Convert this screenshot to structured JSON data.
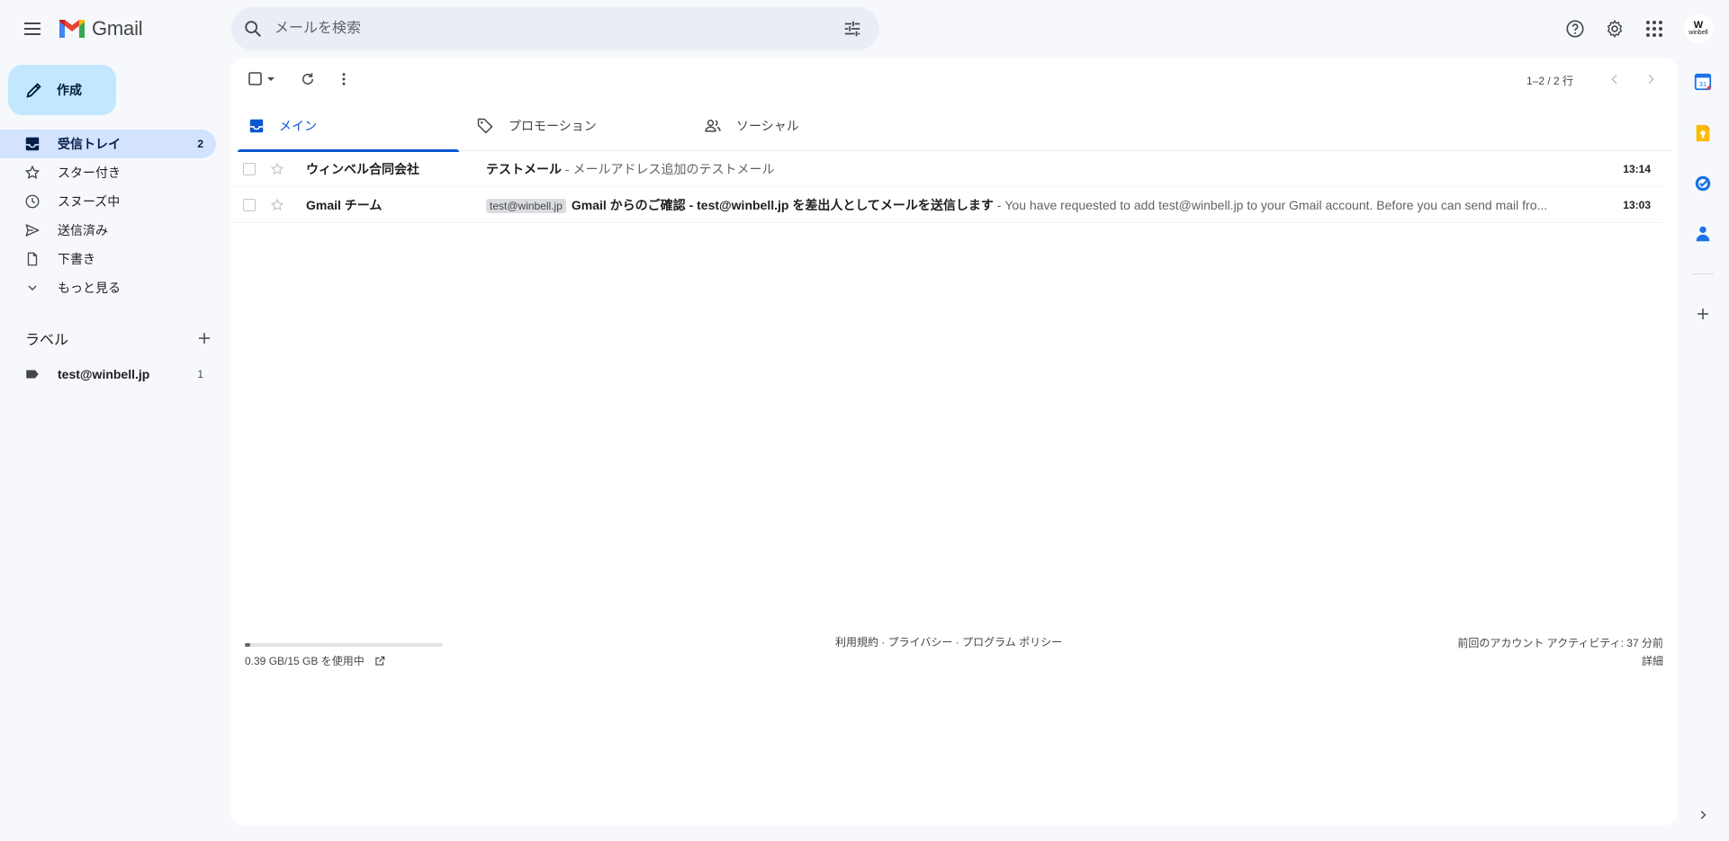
{
  "app": {
    "brand": "Gmail"
  },
  "search": {
    "placeholder": "メールを検索"
  },
  "colors": {
    "accent": "#0b57d0",
    "compose_bg": "#c2e7ff",
    "active_nav": "#d3e3fd"
  },
  "compose": {
    "label": "作成"
  },
  "nav": {
    "items": [
      {
        "label": "受信トレイ",
        "count": "2",
        "icon": "inbox-icon"
      },
      {
        "label": "スター付き",
        "count": "",
        "icon": "star-icon"
      },
      {
        "label": "スヌーズ中",
        "count": "",
        "icon": "clock-icon"
      },
      {
        "label": "送信済み",
        "count": "",
        "icon": "send-icon"
      },
      {
        "label": "下書き",
        "count": "",
        "icon": "draft-icon"
      },
      {
        "label": "もっと見る",
        "count": "",
        "icon": "chevron-down-icon"
      }
    ]
  },
  "labels": {
    "title": "ラベル",
    "items": [
      {
        "label": "test@winbell.jp",
        "count": "1"
      }
    ]
  },
  "toolbar": {
    "pager": "1–2 / 2 行"
  },
  "tabs": [
    {
      "label": "メイン",
      "icon": "inbox-icon"
    },
    {
      "label": "プロモーション",
      "icon": "tag-icon"
    },
    {
      "label": "ソーシャル",
      "icon": "people-icon"
    }
  ],
  "emails": [
    {
      "sender": "ウィンベル合同会社",
      "chip": "",
      "subject": "テストメール",
      "snippet": " - メールアドレス追加のテストメール",
      "time": "13:14"
    },
    {
      "sender": "Gmail チーム",
      "chip": "test@winbell.jp",
      "subject": "Gmail からのご確認 - test@winbell.jp を差出人としてメールを送信します",
      "snippet": " - You have requested to add test@winbell.jp to your Gmail account. Before you can send mail fro...",
      "time": "13:03"
    }
  ],
  "footer": {
    "storage": "0.39 GB/15 GB を使用中",
    "storage_fraction": 0.026,
    "policy": "利用規約 · プライバシー · プログラム ポリシー",
    "activity": "前回のアカウント アクティビティ: 37 分前",
    "details": "詳細"
  },
  "avatar": {
    "mark": "W",
    "text": "winbell"
  },
  "side_panel": {
    "calendar_day": "31"
  }
}
